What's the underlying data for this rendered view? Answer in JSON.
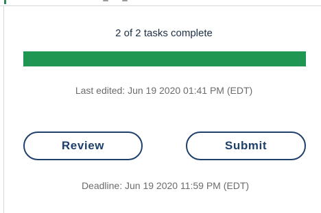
{
  "task_panel": {
    "progress_text": "2 of 2 tasks complete",
    "progress_completed": 2,
    "progress_total": 2,
    "progress_fraction": 1.0,
    "last_edited": "Last edited: Jun 19 2020 01:41 PM (EDT)",
    "review_label": "Review",
    "submit_label": "Submit",
    "deadline": "Deadline: Jun 19 2020 11:59 PM (EDT)"
  },
  "colors": {
    "progress_fill": "#1f9652",
    "button_border": "#1d3f6b",
    "text_primary": "#1c2e44",
    "text_muted": "#6b6b6b"
  }
}
